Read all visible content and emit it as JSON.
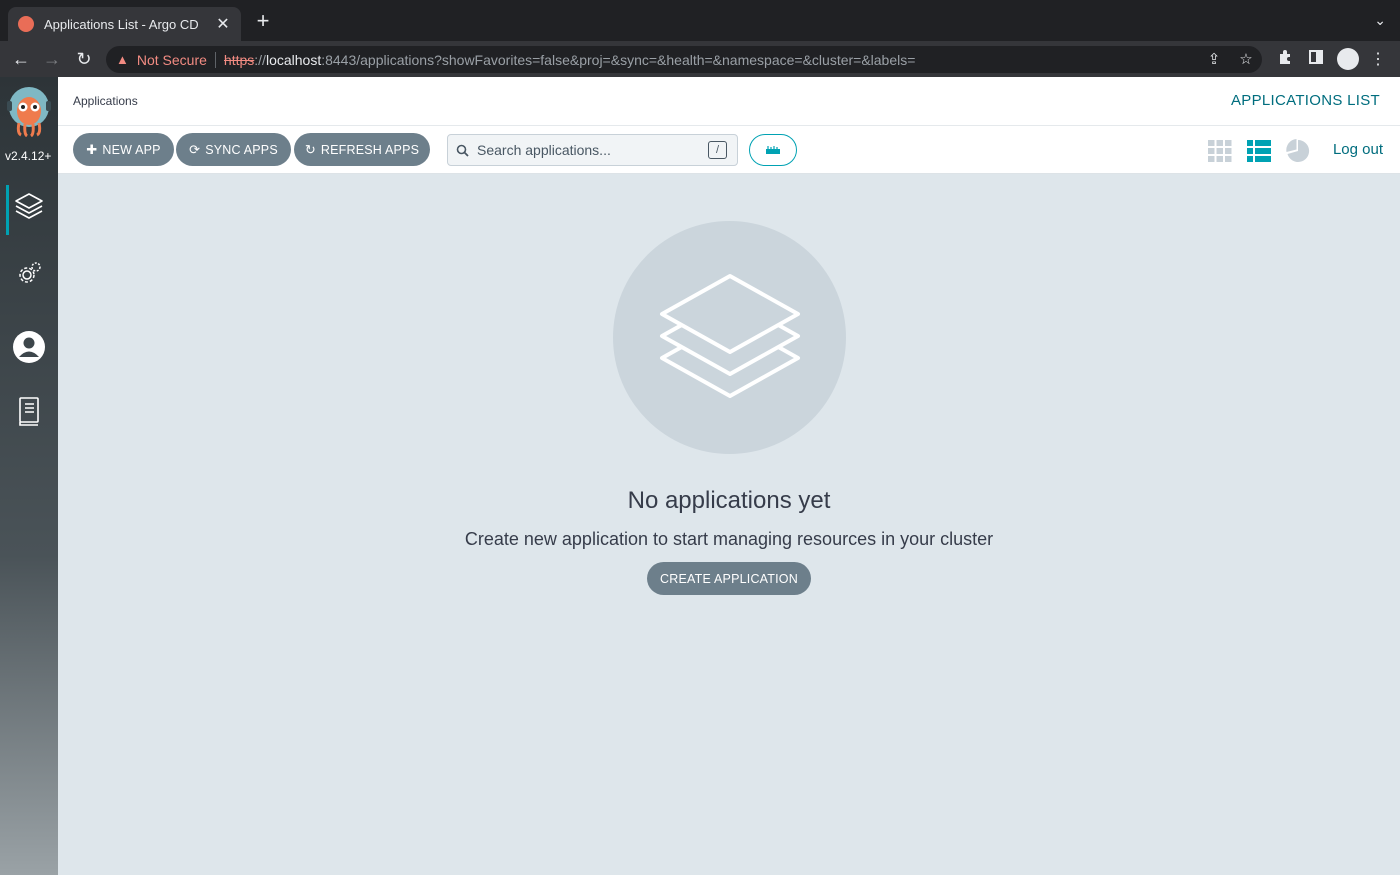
{
  "browser": {
    "tab_title": "Applications List - Argo CD",
    "security_label": "Not Secure",
    "url_scheme": "https",
    "url_sep": "://",
    "url_host": "localhost",
    "url_rest": ":8443/applications?showFavorites=false&proj=&sync=&health=&namespace=&cluster=&labels="
  },
  "sidebar": {
    "version": "v2.4.12+",
    "items": [
      {
        "name": "applications"
      },
      {
        "name": "settings"
      },
      {
        "name": "user-info"
      },
      {
        "name": "documentation"
      }
    ]
  },
  "header": {
    "breadcrumb": "Applications",
    "title": "APPLICATIONS LIST",
    "logout": "Log out"
  },
  "toolbar": {
    "new_app": "NEW APP",
    "sync_apps": "SYNC APPS",
    "refresh_apps": "REFRESH APPS",
    "search_placeholder": "Search applications...",
    "search_shortcut": "/"
  },
  "empty_state": {
    "title": "No applications yet",
    "subtitle": "Create new application to start managing resources in your cluster",
    "button": "CREATE APPLICATION"
  },
  "colors": {
    "accent": "#00a2b3",
    "button_bg": "#6d7f8b",
    "content_bg": "#dee6eb"
  }
}
